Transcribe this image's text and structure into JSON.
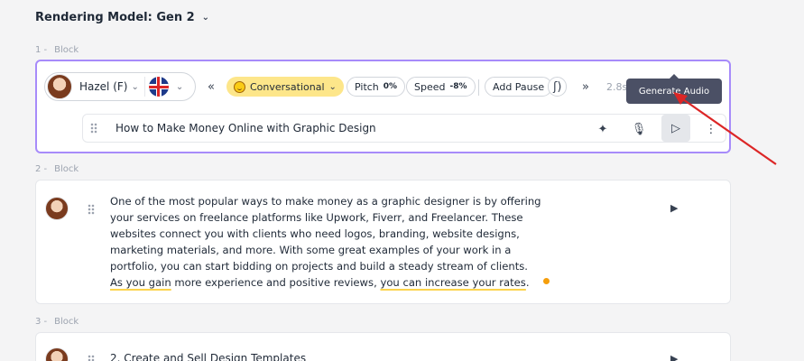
{
  "header": {
    "model_label": "Rendering Model: Gen 2",
    "chevron_icon": "chevron-down-icon"
  },
  "blocks": [
    {
      "number": "1 -",
      "label": "Block",
      "voice": {
        "name": "Hazel (F)",
        "language_flag": "uk-flag-icon"
      },
      "toolbar": {
        "collapse_icon": "double-chevron-left-icon",
        "style_label": "Conversational",
        "pitch_label": "Pitch",
        "pitch_value": "0%",
        "speed_label": "Speed",
        "speed_value": "-8%",
        "add_pause_label": "Add Pause",
        "expand_icon": "double-chevron-right-icon",
        "duration": "2.8s"
      },
      "tooltip": "Generate Audio",
      "text": "How to Make Money Online with Graphic Design"
    },
    {
      "number": "2 -",
      "label": "Block",
      "text_plain": "One of the most popular ways to make money as a graphic designer is by offering your services on freelance platforms like Upwork, Fiverr, and Freelancer. These websites connect you with clients who need logos, branding, website designs, marketing materials, and more. With some great examples of your work in a portfolio, you can start bidding on projects and build a steady stream of clients.",
      "text_underlined_1": "As you gain",
      "text_mid": "more experience and positive reviews,",
      "text_underlined_2": "you can increase your rates",
      "text_end": "."
    },
    {
      "number": "3 -",
      "label": "Block",
      "text": "2. Create and Sell Design Templates"
    }
  ],
  "colors": {
    "active_border": "#a78bfa",
    "style_chip": "#fde68a",
    "tooltip_bg": "#4b5065",
    "annotation_arrow": "#dc2626"
  }
}
